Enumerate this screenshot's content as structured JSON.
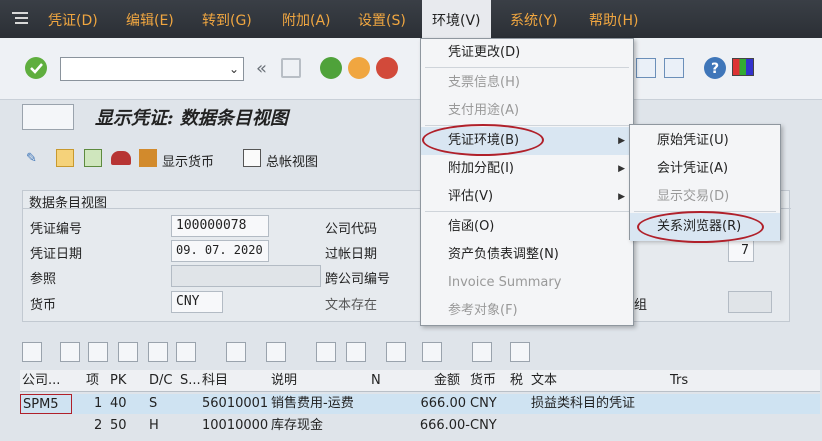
{
  "menubar": {
    "items": [
      "凭证(D)",
      "编辑(E)",
      "转到(G)",
      "附加(A)",
      "设置(S)",
      "环境(V)",
      "系统(Y)",
      "帮助(H)"
    ]
  },
  "header": {
    "title": "显示凭证: 数据条目视图"
  },
  "subtoolbar": {
    "currency": "显示货币",
    "ledger": "总帐视图"
  },
  "panel": {
    "title": "数据条目视图",
    "doc_no_label": "凭证编号",
    "doc_no": "100000078",
    "company_label": "公司代码",
    "doc_date_label": "凭证日期",
    "doc_date": "09. 07. 2020",
    "post_date_label": "过帐日期",
    "period": "7",
    "ref_label": "参照",
    "cross_company_label": "跨公司编号",
    "currency_label": "货币",
    "currency": "CNY",
    "text_exists_label": "文本存在",
    "group_fragment": "组"
  },
  "grid": {
    "headers": [
      "公司...",
      "项",
      "PK",
      "D/C",
      "S...",
      "科目",
      "说明",
      "N",
      "金额",
      "货币",
      "税",
      "文本",
      "Trs"
    ],
    "rows": [
      {
        "company": "SPM5",
        "item": "1",
        "pk": "40",
        "dc": "S",
        "account": "56010001",
        "desc": "销售费用-运费",
        "amount": "666.00",
        "currency": "CNY",
        "text": "损益类科目的凭证"
      },
      {
        "company": "",
        "item": "2",
        "pk": "50",
        "dc": "H",
        "account": "10010000",
        "desc": "库存现金",
        "amount": "666.00-",
        "currency": "CNY",
        "text": ""
      }
    ]
  },
  "env_menu": {
    "items": [
      {
        "label": "凭证更改(D)",
        "enabled": true
      },
      {
        "label": "支票信息(H)",
        "enabled": false
      },
      {
        "label": "支付用途(A)",
        "enabled": false
      },
      {
        "label": "凭证环境(B)",
        "enabled": true,
        "submenu": true
      },
      {
        "label": "附加分配(I)",
        "enabled": true,
        "submenu": true
      },
      {
        "label": "评估(V)",
        "enabled": true,
        "submenu": true
      },
      {
        "label": "信函(O)",
        "enabled": true
      },
      {
        "label": "资产负债表调整(N)",
        "enabled": true
      },
      {
        "label": "Invoice Summary",
        "enabled": false
      },
      {
        "label": "参考对象(F)",
        "enabled": false
      }
    ]
  },
  "sub_menu": {
    "items": [
      {
        "label": "原始凭证(U)",
        "enabled": true
      },
      {
        "label": "会计凭证(A)",
        "enabled": true
      },
      {
        "label": "显示交易(D)",
        "enabled": false
      },
      {
        "label": "关系浏览器(R)",
        "enabled": true
      }
    ]
  },
  "colors": {
    "menu_text": "#f0a640",
    "highlight": "#b0202a",
    "row_selected": "#cfe3f2"
  }
}
